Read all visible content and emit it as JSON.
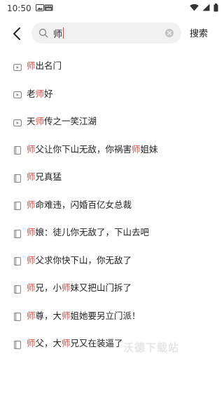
{
  "status_bar": {
    "time": "10:50"
  },
  "search": {
    "query": "师",
    "button_label": "搜索"
  },
  "suggestions": [
    {
      "type": "video",
      "parts": [
        {
          "t": "师",
          "h": true
        },
        {
          "t": "出名门",
          "h": false
        }
      ]
    },
    {
      "type": "video",
      "parts": [
        {
          "t": "老",
          "h": false
        },
        {
          "t": "师",
          "h": true
        },
        {
          "t": "好",
          "h": false
        }
      ]
    },
    {
      "type": "video",
      "parts": [
        {
          "t": "天",
          "h": false
        },
        {
          "t": "师",
          "h": true
        },
        {
          "t": "传之一笑江湖",
          "h": false
        }
      ]
    },
    {
      "type": "book",
      "parts": [
        {
          "t": "师",
          "h": true
        },
        {
          "t": "父让你下山无敌，你祸害",
          "h": false
        },
        {
          "t": "师",
          "h": true
        },
        {
          "t": "姐妹",
          "h": false
        }
      ]
    },
    {
      "type": "book",
      "parts": [
        {
          "t": "师",
          "h": true
        },
        {
          "t": "兄真猛",
          "h": false
        }
      ]
    },
    {
      "type": "book",
      "parts": [
        {
          "t": "师",
          "h": true
        },
        {
          "t": "命难违，闪婚百亿女总裁",
          "h": false
        }
      ]
    },
    {
      "type": "book",
      "parts": [
        {
          "t": "师",
          "h": true
        },
        {
          "t": "娘：徒儿你无敌了，下山去吧",
          "h": false
        }
      ]
    },
    {
      "type": "book",
      "parts": [
        {
          "t": "师",
          "h": true
        },
        {
          "t": "父求你快下山，你无敌了",
          "h": false
        }
      ]
    },
    {
      "type": "book",
      "parts": [
        {
          "t": "师",
          "h": true
        },
        {
          "t": "兄，小",
          "h": false
        },
        {
          "t": "师",
          "h": true
        },
        {
          "t": "妹又把山门拆了",
          "h": false
        }
      ]
    },
    {
      "type": "book",
      "parts": [
        {
          "t": "师",
          "h": true
        },
        {
          "t": "尊，大",
          "h": false
        },
        {
          "t": "师",
          "h": true
        },
        {
          "t": "姐她要另立门派！",
          "h": false
        }
      ]
    },
    {
      "type": "book",
      "parts": [
        {
          "t": "师",
          "h": true
        },
        {
          "t": "父，大",
          "h": false
        },
        {
          "t": "师",
          "h": true
        },
        {
          "t": "兄又在装逼了",
          "h": false
        }
      ]
    }
  ],
  "watermark": "沃德下载站",
  "colors": {
    "highlight": "#e8453c",
    "search_bg": "#f1f1f2",
    "icon": "#8a8a8a"
  }
}
